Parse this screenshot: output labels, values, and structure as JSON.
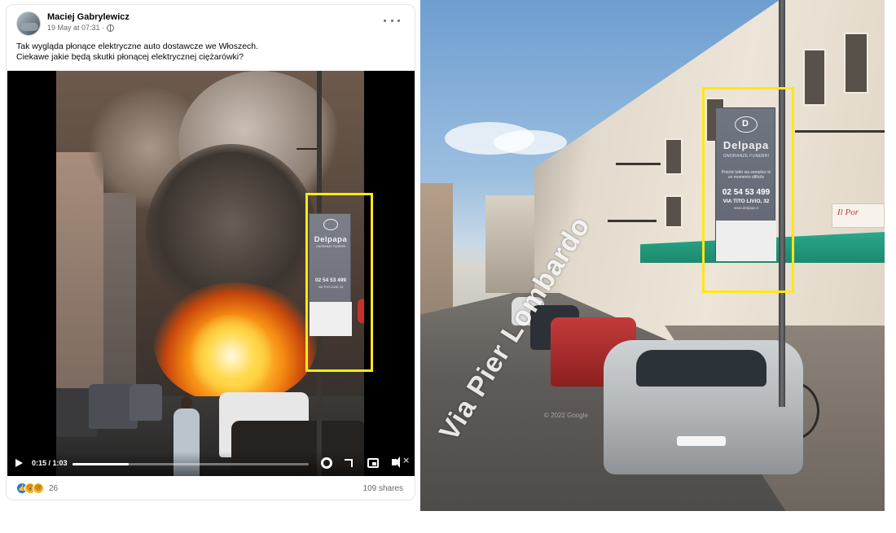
{
  "post": {
    "author": "Maciej Gabrylewicz",
    "date": "19 May at 07:31 ·",
    "text_line1": "Tak wygląda płonące elektryczne auto dostawcze we Włoszech.",
    "text_line2": "Ciekawe jakie będą skutki płonącej elektrycznej ciężarówki?",
    "video": {
      "time": "0:15 / 1:03",
      "progress": 0.238,
      "sign_name": "Delpapa",
      "sign_sub": "ONORANZE FUNEBRI",
      "sign_phone": "02 54 53 499",
      "sign_address": "VIA TITO LIVIO, 32"
    },
    "reaction_count": "26",
    "shares": "109 shares",
    "icons": [
      "globe-icon",
      "more-icon",
      "play-icon",
      "gear-icon",
      "expand-icon",
      "pip-icon",
      "volume-icon",
      "like-icon",
      "wow-icon",
      "sad-icon"
    ]
  },
  "street_view": {
    "street_name": "Via Pier Lombardo",
    "sign_name": "Delpapa",
    "sign_sub": "ONORANZE FUNEBRI",
    "sign_tagline": "Poiché tutto sia semplice in un momento difficile",
    "sign_phone": "02 54 53 499",
    "sign_address": "VIA TITO LIVIO, 32",
    "sign_web": "www.delpapa.it",
    "shop_sign": "Il Por",
    "watermark": "© 2022 Google"
  },
  "colors": {
    "highlight": "#ffe814",
    "fb_blue": "#1877f2",
    "awning": "#1c8a6e"
  }
}
